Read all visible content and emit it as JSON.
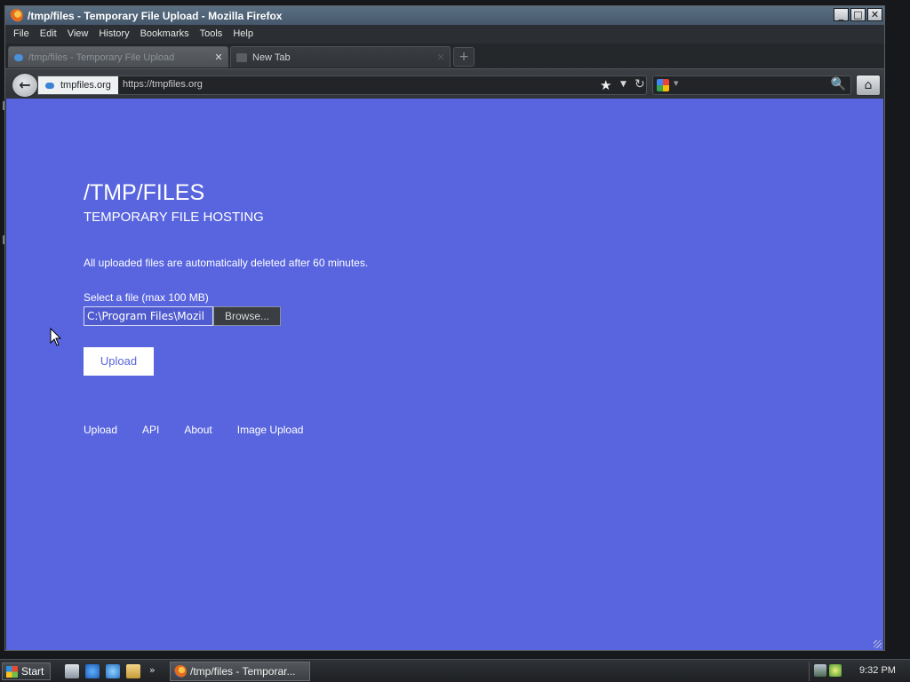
{
  "window": {
    "title": "/tmp/files - Temporary File Upload - Mozilla Firefox",
    "controls": {
      "minimize": "_",
      "maximize": "□",
      "close": "✕"
    }
  },
  "menubar": {
    "items": [
      "File",
      "Edit",
      "View",
      "History",
      "Bookmarks",
      "Tools",
      "Help"
    ]
  },
  "tabs": [
    {
      "label": "/tmp/files - Temporary File Upload",
      "active": true,
      "icon": "cloud-icon"
    },
    {
      "label": "New Tab",
      "active": false,
      "icon": "page-icon"
    }
  ],
  "tab_close_glyph": "✕",
  "new_tab_glyph": "+",
  "navbar": {
    "back_glyph": "←",
    "identity_host": "tmpfiles.org",
    "url": "https://tmpfiles.org",
    "bookmark_star": "★",
    "dropdown_glyph": "▼",
    "reload_glyph": "↻",
    "search_value": "",
    "search_engine": "google-icon",
    "search_glyph": "🔍",
    "home_glyph": "⌂"
  },
  "page": {
    "title": "/TMP/FILES",
    "subtitle": "TEMPORARY FILE HOSTING",
    "notice": "All uploaded files are automatically deleted after 60 minutes.",
    "file_label": "Select a file (max 100 MB)",
    "file_value": "C:\\Program Files\\Mozil",
    "browse_label": "Browse...",
    "upload_label": "Upload",
    "footer_links": [
      "Upload",
      "API",
      "About",
      "Image Upload"
    ],
    "colors": {
      "background": "#5865de",
      "text": "#ffffff",
      "button_bg": "#ffffff",
      "button_text": "#5865de"
    }
  },
  "taskbar": {
    "start_label": "Start",
    "quicklaunch_more": "»",
    "task_label": "/tmp/files - Temporar...",
    "clock": "9:32 PM"
  }
}
